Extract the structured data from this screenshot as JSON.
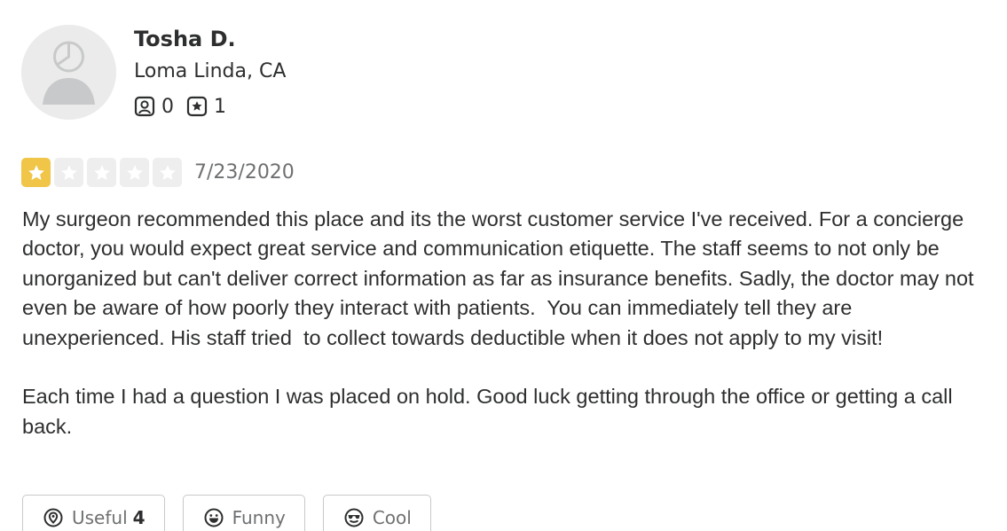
{
  "reviewer": {
    "name": "Tosha D.",
    "location": "Loma Linda, CA",
    "friends_count": "0",
    "reviews_count": "1"
  },
  "review": {
    "rating": 1,
    "max_rating": 5,
    "date": "7/23/2020",
    "paragraphs": [
      "My surgeon recommended this place and its the worst customer service I've received. For a concierge doctor, you would expect great service and communication etiquette. The staff seems to not only be unorganized but can't deliver correct information as far as insurance benefits. Sadly, the doctor may not even be aware of how poorly they interact with patients.  You can immediately tell they are unexperienced. His staff tried  to collect towards deductible when it does not apply to my visit!",
      "Each time I had a question I was placed on hold. Good luck getting through the office or getting a call back."
    ]
  },
  "reactions": {
    "useful_label": "Useful",
    "useful_count": "4",
    "funny_label": "Funny",
    "cool_label": "Cool"
  },
  "colors": {
    "star_filled": "#f0c548",
    "star_empty": "#eeeeee",
    "text_primary": "#2d2e2f",
    "text_secondary": "#6e7072"
  },
  "icons": {
    "avatar": "default-user-icon",
    "friends": "friends-icon",
    "reviews": "reviews-star-icon",
    "useful": "useful-icon",
    "funny": "funny-face-icon",
    "cool": "cool-sunglasses-icon"
  }
}
